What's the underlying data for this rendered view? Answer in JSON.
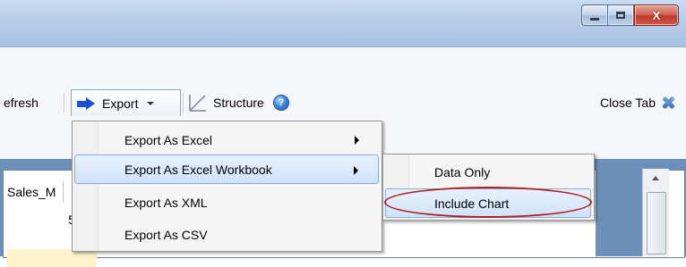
{
  "window": {
    "controls": {
      "close_glyph": "X"
    }
  },
  "toolbar": {
    "refresh_label": "efresh",
    "export_label": "Export",
    "structure_label": "Structure",
    "help_glyph": "?",
    "close_tab_label": "Close Tab"
  },
  "export_menu": {
    "items": [
      {
        "label": "Export As Excel",
        "has_submenu": true
      },
      {
        "label": "Export As Excel Workbook",
        "has_submenu": true,
        "highlighted": true
      },
      {
        "label": "Export As XML",
        "has_submenu": false
      },
      {
        "label": "Export As CSV",
        "has_submenu": false
      }
    ]
  },
  "workbook_submenu": {
    "items": [
      {
        "label": "Data Only"
      },
      {
        "label": "Include Chart",
        "highlighted": true,
        "annotated": true
      }
    ]
  },
  "grid": {
    "column_header": "Sales_M",
    "cell_value": "5"
  },
  "colors": {
    "accent_blue": "#1b4fcf",
    "highlight_border": "#84acdd",
    "annotation_red": "#b01e1e"
  },
  "icons": {
    "export": "arrow-right-icon",
    "structure": "structure-icon",
    "help": "help-icon",
    "close_tab": "close-x-icon"
  }
}
